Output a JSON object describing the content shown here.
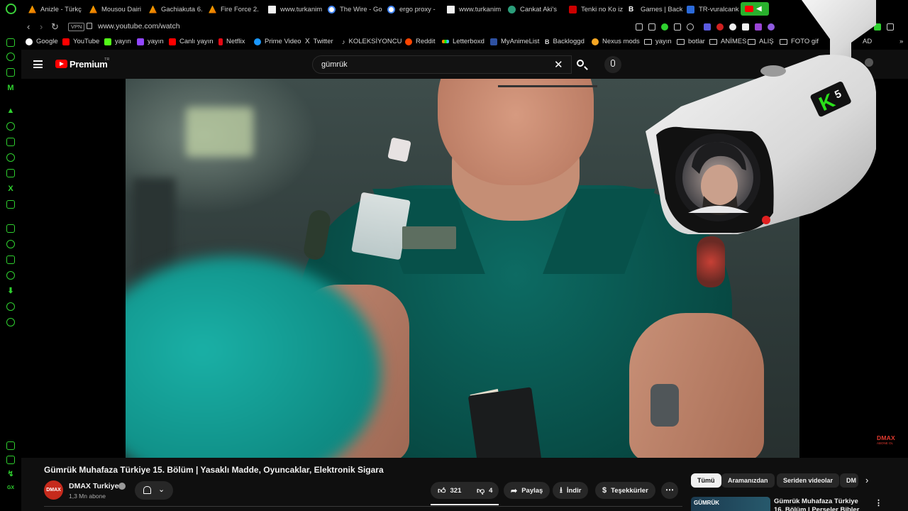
{
  "browser": {
    "tabs": [
      {
        "label": "Anizle - Türkç",
        "icon": "anizle-icon"
      },
      {
        "label": "Mousou Dairi",
        "icon": "anizle-icon"
      },
      {
        "label": "Gachiakuta 6.",
        "icon": "anizle-icon"
      },
      {
        "label": "Fire Force 2.",
        "icon": "anizle-icon"
      },
      {
        "label": "www.turkanim",
        "icon": "document-icon"
      },
      {
        "label": "The Wire - Go",
        "icon": "google-icon"
      },
      {
        "label": "ergo proxy -",
        "icon": "google-icon"
      },
      {
        "label": "www.turkanim",
        "icon": "document-icon"
      },
      {
        "label": "Cankat Aki's",
        "icon": "globe-icon"
      },
      {
        "label": "Tenki no Ko iz",
        "icon": "site-icon"
      },
      {
        "label": "Games | Back",
        "icon": "backloggd-icon"
      },
      {
        "label": "TR-vuralcank",
        "icon": "site-icon"
      }
    ],
    "url": "www.youtube.com/watch",
    "vpn_label": "VPN",
    "bookmarks": [
      {
        "label": "Google",
        "icon": "google-icon"
      },
      {
        "label": "YouTube",
        "icon": "youtube-icon"
      },
      {
        "label": "yayın",
        "icon": "kick-icon"
      },
      {
        "label": "yayın",
        "icon": "twitch-icon"
      },
      {
        "label": "Canlı yayın",
        "icon": "youtube-icon"
      },
      {
        "label": "Netflix",
        "icon": "netflix-icon"
      },
      {
        "label": "Prime Video",
        "icon": "prime-video-icon"
      },
      {
        "label": "Twitter",
        "icon": "x-icon"
      },
      {
        "label": "KOLEKSİYONCU",
        "icon": "tiktok-icon"
      },
      {
        "label": "Reddit",
        "icon": "reddit-icon"
      },
      {
        "label": "Letterboxd",
        "icon": "letterboxd-icon"
      },
      {
        "label": "MyAnimeList",
        "icon": "mal-icon"
      },
      {
        "label": "Backloggd",
        "icon": "backloggd-icon"
      },
      {
        "label": "Nexus mods",
        "icon": "nexus-icon"
      },
      {
        "label": "yayın",
        "icon": "folder-icon"
      },
      {
        "label": "botlar",
        "icon": "folder-icon"
      },
      {
        "label": "ANİMES",
        "icon": "folder-icon"
      },
      {
        "label": "ALIŞ",
        "icon": "folder-icon"
      },
      {
        "label": "FOTO gif",
        "icon": "folder-icon"
      },
      {
        "label": "AD",
        "icon": "folder-icon"
      }
    ]
  },
  "youtube": {
    "logo_text": "Premium",
    "region": "TR",
    "search_query": "gümrük",
    "channel_bug": {
      "name": "DMAX",
      "tagline": "ABONE OL"
    },
    "overlay_badge": "5",
    "video": {
      "title": "Gümrük Muhafaza Türkiye 15. Bölüm | Yasaklı Madde, Oyuncaklar, Elektronik Sigara",
      "channel": "DMAX Turkiye",
      "avatar_text": "DMAX",
      "subscribers": "1,3 Mn abone",
      "likes": "321",
      "dislikes": "4",
      "share_label": "Paylaş",
      "download_label": "İndir",
      "thanks_label": "Teşekkürler"
    },
    "chips": [
      {
        "label": "Tümü",
        "active": true
      },
      {
        "label": "Aramanızdan",
        "active": false
      },
      {
        "label": "Seriden videolar",
        "active": false
      },
      {
        "label": "DM",
        "active": false
      }
    ],
    "recommendation": {
      "title": "Gümrük Muhafaza Türkiye 16. Bölüm | Perseler Bibler",
      "thumb_text": "GÜMRÜK"
    }
  },
  "colors": {
    "opera_green": "#2fd12f",
    "youtube_red": "#ff0000",
    "dmax_red": "#e23a2f"
  }
}
